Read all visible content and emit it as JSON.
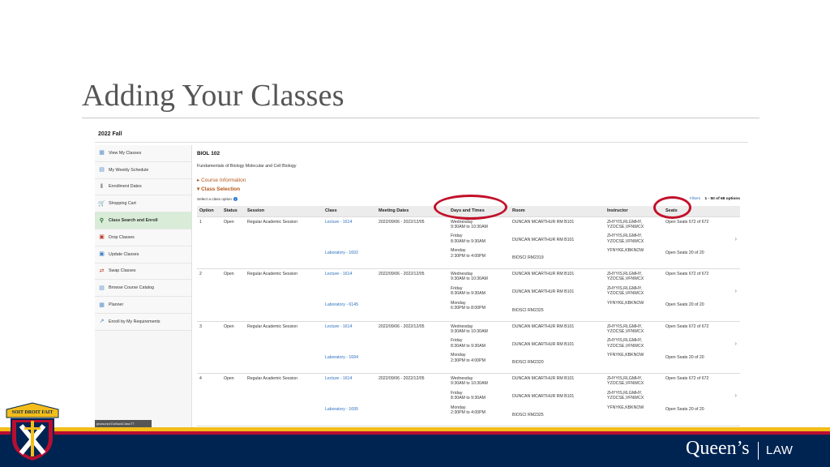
{
  "slide": {
    "title": "Adding Your Classes",
    "brand": "Queen’s",
    "brand_suffix": "LAW",
    "crest_motto": "SOIT DROIT FAIT"
  },
  "colors": {
    "accent_orange": "#b4561a",
    "link_blue": "#2a6fbf",
    "highlight_red": "#c2112a",
    "navy": "#002452",
    "gold": "#f3bd1a",
    "red_band": "#b90e31",
    "active_nav": "#d8ecd8"
  },
  "screen": {
    "term": "2022 Fall",
    "sidebar": {
      "items": [
        {
          "label": "View My Classes",
          "icon": "calendar-list-icon"
        },
        {
          "label": "My Weekly Schedule",
          "icon": "weekly-schedule-icon"
        },
        {
          "label": "Enrollment Dates",
          "icon": "enrollment-dates-icon"
        },
        {
          "label": "Shopping Cart",
          "icon": "shopping-cart-icon"
        },
        {
          "label": "Class Search and Enroll",
          "icon": "search-icon",
          "active": true
        },
        {
          "label": "Drop Classes",
          "icon": "drop-icon"
        },
        {
          "label": "Update Classes",
          "icon": "update-icon"
        },
        {
          "label": "Swap Classes",
          "icon": "swap-icon"
        },
        {
          "label": "Browse Course Catalog",
          "icon": "catalog-icon"
        },
        {
          "label": "Planner",
          "icon": "planner-icon"
        },
        {
          "label": "Enroll by My Requirements",
          "icon": "requirements-icon"
        }
      ],
      "footer_text": "javascript:DoBackClassTT"
    },
    "course": {
      "code": "BIOL 102",
      "name": "Fundamentals of Biology  Molecular and Cell Biology",
      "course_info_label": "Course Information",
      "class_selection_label": "Class Selection",
      "select_prompt": "Select a class option",
      "pager_link": "Filters",
      "pager_text": "1 - 50 of 68 options"
    },
    "columns": [
      "Option",
      "Status",
      "Session",
      "Class",
      "Meeting Dates",
      "Days and Times",
      "Room",
      "Instructor",
      "Seats"
    ],
    "options": [
      {
        "option": "1",
        "status": "Open",
        "session": "Regular Academic Session",
        "lecture": "Lecture - 1614",
        "lab": "Laboratory - 1692",
        "dates": "2022/09/06 - 2022/12/05",
        "times": [
          "Wednesday",
          "9:30AM to 10:30AM",
          "Friday",
          "8:30AM to 9:30AM",
          "Monday",
          "2:30PM to 4:00PM"
        ],
        "rooms": [
          "DUNCAN MCARTHUR RM B101",
          "DUNCAN MCARTHUR RM B101",
          "BIOSCI RM2319"
        ],
        "instructors": [
          "ZHYYIS,RLGMHY,",
          "YZOCSE,VFNWCX",
          "ZHYYIS,RLGMHY,",
          "YZOCSE,VFNWCX",
          "YFNYKE,KBKNOW"
        ],
        "seats": [
          "Open Seats 672 of 672",
          "Open Seats 20 of 20"
        ]
      },
      {
        "option": "2",
        "status": "Open",
        "session": "Regular Academic Session",
        "lecture": "Lecture - 1614",
        "lab": "Laboratory - 6145",
        "dates": "2022/09/06 - 2022/12/05",
        "times": [
          "Wednesday",
          "9:30AM to 10:30AM",
          "Friday",
          "8:30AM to 9:30AM",
          "Monday",
          "6:30PM to 8:00PM"
        ],
        "rooms": [
          "DUNCAN MCARTHUR RM B101",
          "DUNCAN MCARTHUR RM B101",
          "BIOSCI RM2325"
        ],
        "instructors": [
          "ZHYYIS,RLGMHY,",
          "YZOCSE,VFNWCX",
          "ZHYYIS,RLGMHY,",
          "YZOCSE,VFNWCX",
          "YFNYKE,KBKNOW"
        ],
        "seats": [
          "Open Seats 672 of 672",
          "Open Seats 20 of 20"
        ]
      },
      {
        "option": "3",
        "status": "Open",
        "session": "Regular Academic Session",
        "lecture": "Lecture - 1614",
        "lab": "Laboratory - 1694",
        "dates": "2022/09/06 - 2022/12/05",
        "times": [
          "Wednesday",
          "9:30AM to 10:30AM",
          "Friday",
          "8:30AM to 9:30AM",
          "Monday",
          "2:30PM to 4:00PM"
        ],
        "rooms": [
          "DUNCAN MCARTHUR RM B101",
          "DUNCAN MCARTHUR RM B101",
          "BIOSCI RM2320"
        ],
        "instructors": [
          "ZHYYIS,RLGMHY,",
          "YZOCSE,VFNWCX",
          "ZHYYIS,RLGMHY,",
          "YZOCSE,VFNWCX",
          "YFNYKE,KBKNOW"
        ],
        "seats": [
          "Open Seats 672 of 672",
          "Open Seats 20 of 20"
        ]
      },
      {
        "option": "4",
        "status": "Open",
        "session": "Regular Academic Session",
        "lecture": "Lecture - 1614",
        "lab": "Laboratory - 1695",
        "dates": "2022/09/06 - 2022/12/05",
        "times": [
          "Wednesday",
          "9:30AM to 10:30AM",
          "Friday",
          "8:30AM to 9:30AM",
          "Monday",
          "2:30PM to 4:00PM"
        ],
        "rooms": [
          "DUNCAN MCARTHUR RM B101",
          "DUNCAN MCARTHUR RM B101",
          "BIOSCI RM2325"
        ],
        "instructors": [
          "ZHYYIS,RLGMHY,",
          "YZOCSE,VFNWCX",
          "ZHYYIS,RLGMHY,",
          "YZOCSE,VFNWCX",
          "YFNYKE,KBKNOW"
        ],
        "seats": [
          "Open Seats 672 of 672",
          "Open Seats 20 of 20"
        ]
      }
    ]
  }
}
